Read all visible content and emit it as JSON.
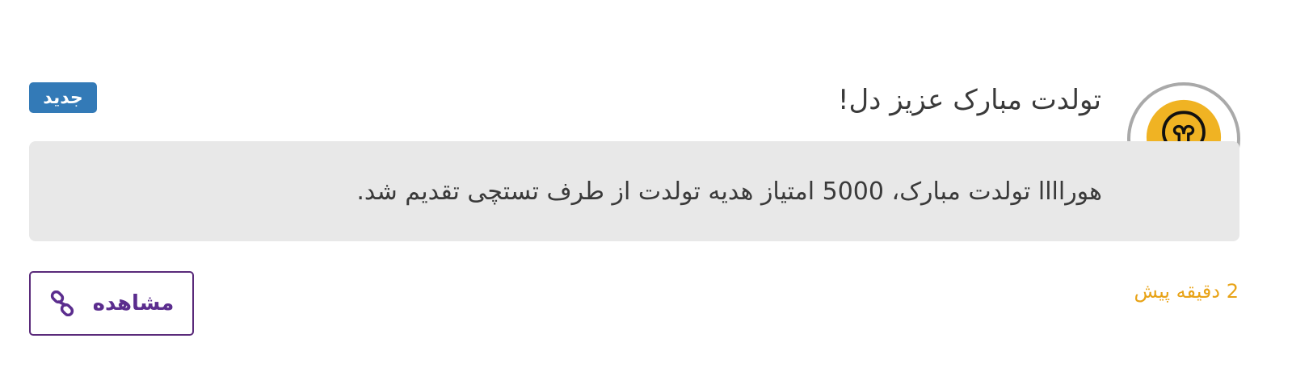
{
  "notification": {
    "title": "تولدت مبارک عزیز دل!",
    "badge": "جدید",
    "message": "هوراااا تولدت مبارک، 5000 امتیاز هدیه تولدت از طرف تستچی تقدیم شد.",
    "time": "2 دقیقه پیش",
    "view_label": "مشاهده",
    "avatar_icon": "lightbulb-icon",
    "view_icon": "link-icon"
  },
  "colors": {
    "badge_bg": "#337ab7",
    "time_text": "#e8a317",
    "button_accent": "#5b2d8e",
    "message_bg": "#e8e8e8",
    "avatar_border": "#a9a9a9",
    "avatar_fill": "#f0b323"
  }
}
